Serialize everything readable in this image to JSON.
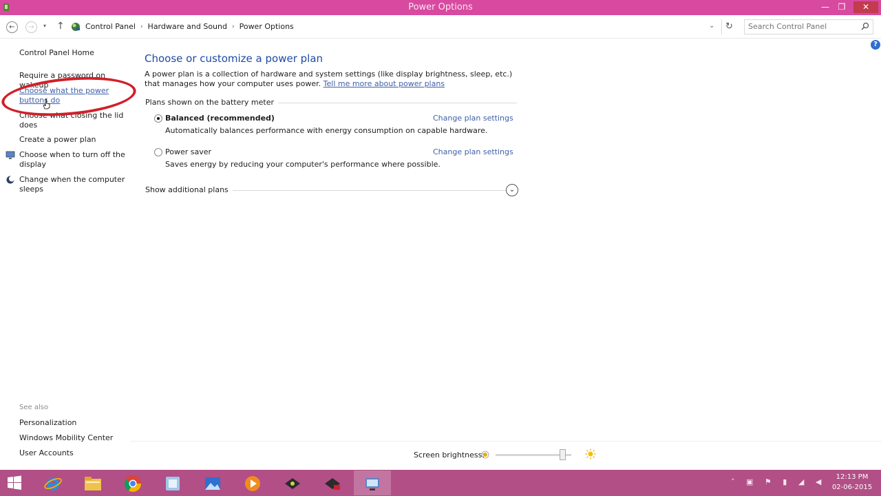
{
  "window": {
    "title": "Power Options",
    "buttons": {
      "minimize": "—",
      "maximize": "❐",
      "close": "✕"
    }
  },
  "nav": {
    "back": "←",
    "forward": "→",
    "recent": "▾",
    "up": "↑",
    "breadcrumbs": [
      "Control Panel",
      "Hardware and Sound",
      "Power Options"
    ],
    "separator": "›",
    "dropdown": "⌄",
    "refresh": "↻",
    "search_placeholder": "Search Control Panel"
  },
  "left_pane": {
    "home": "Control Panel Home",
    "links": [
      "Require a password on wakeup",
      "Choose what the power buttons do",
      "Choose what closing the lid does",
      "Create a power plan",
      "Choose when to turn off the display",
      "Change when the computer sleeps"
    ],
    "see_also": "See also",
    "see_also_links": [
      "Personalization",
      "Windows Mobility Center",
      "User Accounts"
    ]
  },
  "main": {
    "title": "Choose or customize a power plan",
    "description": "A power plan is a collection of hardware and system settings (like display brightness, sleep, etc.) that manages how your computer uses power.",
    "learn_more": "Tell me more about power plans",
    "group_heading": "Plans shown on the battery meter",
    "plans": [
      {
        "name": "Balanced (recommended)",
        "selected": true,
        "description": "Automatically balances performance with energy consumption on capable hardware.",
        "link": "Change plan settings"
      },
      {
        "name": "Power saver",
        "selected": false,
        "description": "Saves energy by reducing your computer's performance where possible.",
        "link": "Change plan settings"
      }
    ],
    "show_additional": "Show additional plans",
    "expand": "⌄",
    "help": "?"
  },
  "brightness": {
    "label": "Screen brightness:",
    "level": 0.92
  },
  "taskbar": {
    "items": [
      "internet-explorer",
      "file-explorer",
      "chrome",
      "app",
      "photos",
      "media-player",
      "app-dark",
      "app-dark-2",
      "control-panel"
    ],
    "active_index": 8,
    "tray": [
      "˄",
      "▣",
      "⚑",
      "▮",
      "◢",
      "◀"
    ],
    "time": "12:13 PM",
    "date": "02-06-2015"
  },
  "colors": {
    "titlebar": "#d74a9f",
    "taskbar": "#b14f86",
    "link": "#3d5fa8",
    "heading": "#1e4aa6",
    "annotation": "#d0202a"
  }
}
